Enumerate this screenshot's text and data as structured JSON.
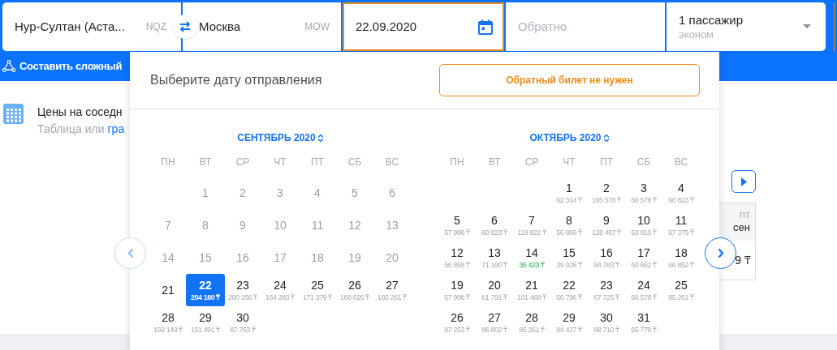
{
  "search_form": {
    "origin": {
      "value": "Нур-Султан (Аста...",
      "code": "NQZ"
    },
    "destination": {
      "value": "Москва",
      "code": "MOW"
    },
    "depart_date": {
      "value": "22.09.2020"
    },
    "return_date": {
      "placeholder": "Обратно"
    },
    "passengers": {
      "value": "1 пассажир",
      "class": "эконом"
    }
  },
  "complex_route_link": "Составить сложный",
  "nearby_prices": {
    "title": "Цены на соседн",
    "subtitle": "Таблица или ",
    "link": "гра"
  },
  "price_table": {
    "header_day": "пт",
    "header_month": "сен",
    "cell": "9 ₸"
  },
  "date_picker": {
    "title": "Выберите дату отправления",
    "one_way_button": "Обратный билет не нужен",
    "months": [
      {
        "label": "СЕНТЯБРЬ 2020",
        "weekdays": [
          "ПН",
          "ВТ",
          "СР",
          "ЧТ",
          "ПТ",
          "СБ",
          "ВС"
        ],
        "weeks": [
          [
            {
              "day": "1",
              "disabled": true,
              "selected": false
            },
            {
              "day": "2",
              "disabled": true,
              "selected": false
            },
            {
              "day": "3",
              "disabled": true,
              "selected": false
            },
            {
              "day": "4",
              "disabled": true,
              "selected": false
            },
            {
              "day": "5",
              "disabled": true,
              "selected": false
            },
            {
              "day": "6",
              "disabled": true,
              "selected": false
            }
          ],
          [
            {
              "day": "7",
              "disabled": true,
              "selected": false
            },
            {
              "day": "8",
              "disabled": true,
              "selected": false
            },
            {
              "day": "9",
              "disabled": true,
              "selected": false
            },
            {
              "day": "10",
              "disabled": true,
              "selected": false
            },
            {
              "day": "11",
              "disabled": true,
              "selected": false
            },
            {
              "day": "12",
              "disabled": true,
              "selected": false
            },
            {
              "day": "13",
              "disabled": true,
              "selected": false
            }
          ],
          [
            {
              "day": "14",
              "disabled": true,
              "selected": false
            },
            {
              "day": "15",
              "disabled": true,
              "selected": false
            },
            {
              "day": "16",
              "disabled": true,
              "selected": false
            },
            {
              "day": "17",
              "disabled": true,
              "selected": false
            },
            {
              "day": "18",
              "disabled": true,
              "selected": false
            },
            {
              "day": "19",
              "disabled": true,
              "selected": false
            },
            {
              "day": "20",
              "disabled": true,
              "selected": false
            }
          ],
          [
            {
              "day": "21",
              "disabled": false,
              "selected": false
            },
            {
              "day": "22",
              "price": "204 160 ₸",
              "disabled": false,
              "selected": true,
              "cheapest": false
            },
            {
              "day": "23",
              "price": "200 156 ₸",
              "disabled": false,
              "selected": false,
              "cheapest": false
            },
            {
              "day": "24",
              "price": "164 283 ₸",
              "disabled": false,
              "selected": false,
              "cheapest": false
            },
            {
              "day": "25",
              "price": "171 379 ₸",
              "disabled": false,
              "selected": false,
              "cheapest": false
            },
            {
              "day": "26",
              "price": "168 026 ₸",
              "disabled": false,
              "selected": false,
              "cheapest": false
            },
            {
              "day": "27",
              "price": "165 261 ₸",
              "disabled": false,
              "selected": false,
              "cheapest": false
            }
          ],
          [
            {
              "day": "28",
              "price": "159 149 ₸",
              "disabled": false,
              "selected": false,
              "cheapest": false
            },
            {
              "day": "29",
              "price": "151 491 ₸",
              "disabled": false,
              "selected": false,
              "cheapest": false
            },
            {
              "day": "30",
              "price": "87 753 ₸",
              "disabled": false,
              "selected": false,
              "cheapest": false
            }
          ]
        ]
      },
      {
        "label": "ОКТЯБРЬ 2020",
        "weekdays": [
          "ПН",
          "ВТ",
          "СР",
          "ЧТ",
          "ПТ",
          "СБ",
          "ВС"
        ],
        "weeks": [
          [
            {
              "day": "1",
              "price": "62 314 ₸",
              "disabled": false,
              "selected": false,
              "cheapest": false
            },
            {
              "day": "2",
              "price": "165 578 ₸",
              "disabled": false,
              "selected": false,
              "cheapest": false
            },
            {
              "day": "3",
              "price": "60 578 ₸",
              "disabled": false,
              "selected": false,
              "cheapest": false
            },
            {
              "day": "4",
              "price": "60 823 ₸",
              "disabled": false,
              "selected": false,
              "cheapest": false
            }
          ],
          [
            {
              "day": "5",
              "price": "57 998 ₸",
              "disabled": false,
              "selected": false,
              "cheapest": false
            },
            {
              "day": "6",
              "price": "60 823 ₸",
              "disabled": false,
              "selected": false,
              "cheapest": false
            },
            {
              "day": "7",
              "price": "119 822 ₸",
              "disabled": false,
              "selected": false,
              "cheapest": false
            },
            {
              "day": "8",
              "price": "56 869 ₸",
              "disabled": false,
              "selected": false,
              "cheapest": false
            },
            {
              "day": "9",
              "price": "128 487 ₸",
              "disabled": false,
              "selected": false,
              "cheapest": false
            },
            {
              "day": "10",
              "price": "63 810 ₸",
              "disabled": false,
              "selected": false,
              "cheapest": false
            },
            {
              "day": "11",
              "price": "67 375 ₸",
              "disabled": false,
              "selected": false,
              "cheapest": false
            }
          ],
          [
            {
              "day": "12",
              "price": "56 858 ₸",
              "disabled": false,
              "selected": false,
              "cheapest": false
            },
            {
              "day": "13",
              "price": "71 190 ₸",
              "disabled": false,
              "selected": false,
              "cheapest": false
            },
            {
              "day": "14",
              "price": "35 423 ₸",
              "disabled": false,
              "selected": false,
              "cheapest": true
            },
            {
              "day": "15",
              "price": "39 928 ₸",
              "disabled": false,
              "selected": false,
              "cheapest": false
            },
            {
              "day": "16",
              "price": "84 783 ₸",
              "disabled": false,
              "selected": false,
              "cheapest": false
            },
            {
              "day": "17",
              "price": "60 662 ₸",
              "disabled": false,
              "selected": false,
              "cheapest": false
            },
            {
              "day": "18",
              "price": "66 852 ₸",
              "disabled": false,
              "selected": false,
              "cheapest": false
            }
          ],
          [
            {
              "day": "19",
              "price": "57 998 ₸",
              "disabled": false,
              "selected": false,
              "cheapest": false
            },
            {
              "day": "20",
              "price": "61 791 ₸",
              "disabled": false,
              "selected": false,
              "cheapest": false
            },
            {
              "day": "21",
              "price": "101 468 ₸",
              "disabled": false,
              "selected": false,
              "cheapest": false
            },
            {
              "day": "22",
              "price": "56 796 ₸",
              "disabled": false,
              "selected": false,
              "cheapest": false
            },
            {
              "day": "23",
              "price": "67 725 ₸",
              "disabled": false,
              "selected": false,
              "cheapest": false
            },
            {
              "day": "24",
              "price": "60 578 ₸",
              "disabled": false,
              "selected": false,
              "cheapest": false
            },
            {
              "day": "25",
              "price": "85 261 ₸",
              "disabled": false,
              "selected": false,
              "cheapest": false
            }
          ],
          [
            {
              "day": "26",
              "price": "87 253 ₸",
              "disabled": false,
              "selected": false,
              "cheapest": false
            },
            {
              "day": "27",
              "price": "86 802 ₸",
              "disabled": false,
              "selected": false,
              "cheapest": false
            },
            {
              "day": "28",
              "price": "85 261 ₸",
              "disabled": false,
              "selected": false,
              "cheapest": false
            },
            {
              "day": "29",
              "price": "84 427 ₸",
              "disabled": false,
              "selected": false,
              "cheapest": false
            },
            {
              "day": "30",
              "price": "88 710 ₸",
              "disabled": false,
              "selected": false,
              "cheapest": false
            },
            {
              "day": "31",
              "price": "65 779 ₸",
              "disabled": false,
              "selected": false,
              "cheapest": false
            }
          ]
        ]
      }
    ]
  }
}
